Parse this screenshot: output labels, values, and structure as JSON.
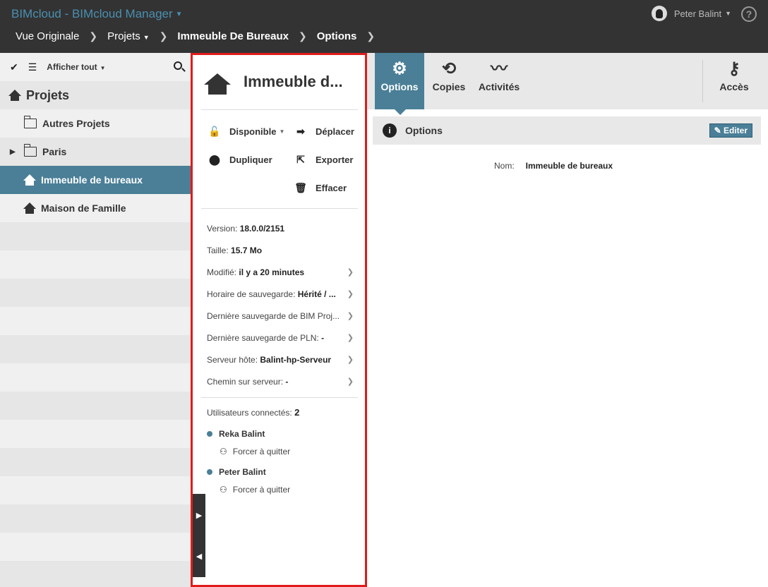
{
  "header": {
    "app_title": "BIMcloud - BIMcloud Manager",
    "user_name": "Peter Balint",
    "help_label": "?"
  },
  "breadcrumb": {
    "items": [
      "Vue Originale",
      "Projets",
      "Immeuble De Bureaux",
      "Options"
    ]
  },
  "sidebar": {
    "filter_label": "Afficher tout",
    "section_title": "Projets",
    "items": [
      {
        "label": "Autres Projets",
        "type": "folder"
      },
      {
        "label": "Paris",
        "type": "folder"
      },
      {
        "label": "Immeuble de bureaux",
        "type": "project",
        "selected": true
      },
      {
        "label": "Maison de Famille",
        "type": "project"
      }
    ]
  },
  "details": {
    "title": "Immeuble d...",
    "actions": {
      "availability": "Disponible",
      "move": "Déplacer",
      "duplicate": "Dupliquer",
      "export": "Exporter",
      "delete": "Effacer"
    },
    "info": [
      {
        "label": "Version:",
        "value": "18.0.0/2151"
      },
      {
        "label": "Taille:",
        "value": "15.7 Mo"
      },
      {
        "label": "Modifié:",
        "value": "il y a 20 minutes"
      },
      {
        "label": "Horaire de sauvegarde:",
        "value": "Hérité / ..."
      },
      {
        "label": "Dernière sauvegarde de BIM Proj...",
        "value": ""
      },
      {
        "label": "Dernière sauvegarde de PLN:",
        "value": "-"
      },
      {
        "label": "Serveur hôte:",
        "value": "Balint-hp-Serveur"
      },
      {
        "label": "Chemin sur serveur:",
        "value": "-"
      }
    ],
    "connected_label": "Utilisateurs connectés:",
    "connected_count": "2",
    "users": [
      {
        "name": "Reka Balint",
        "action": "Forcer à quitter"
      },
      {
        "name": "Peter Balint",
        "action": "Forcer à quitter"
      }
    ]
  },
  "tabs": {
    "options": "Options",
    "copies": "Copies",
    "activities": "Activités",
    "access": "Accès"
  },
  "options_panel": {
    "title": "Options",
    "edit_label": "Editer",
    "name_label": "Nom:",
    "name_value": "Immeuble de bureaux"
  },
  "colors": {
    "accent": "#4a7f97",
    "header_bg": "#333333",
    "highlight_border": "#e01b1b"
  }
}
